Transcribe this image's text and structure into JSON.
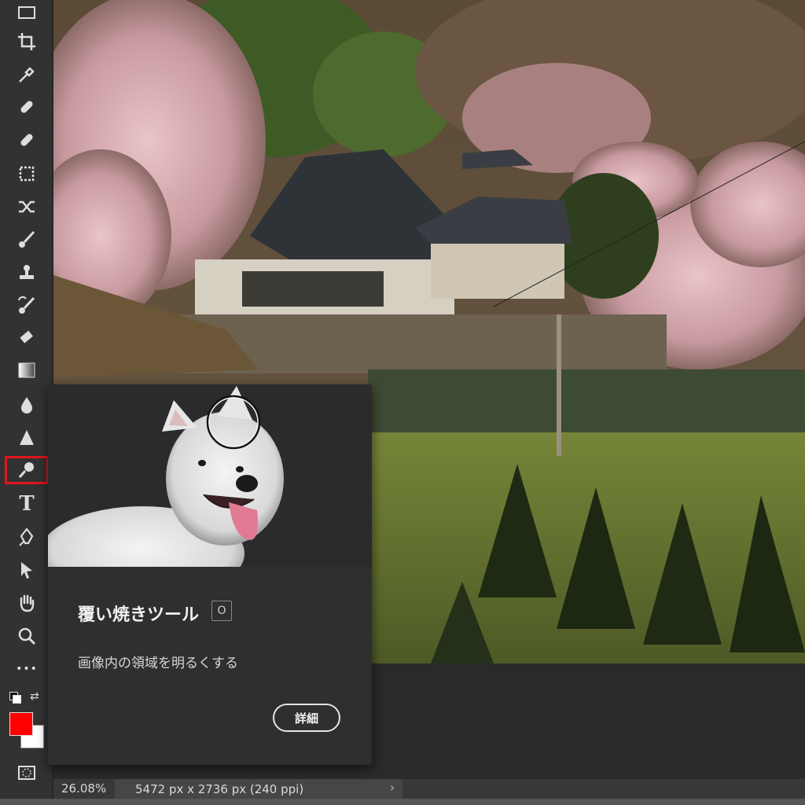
{
  "toolbar": {
    "tools": [
      {
        "name": "marquee-tool-icon"
      },
      {
        "name": "crop-tool-icon"
      },
      {
        "name": "eyedropper-tool-icon"
      },
      {
        "name": "spot-healing-tool-icon"
      },
      {
        "name": "healing-brush-tool-icon"
      },
      {
        "name": "patch-tool-icon"
      },
      {
        "name": "content-aware-move-tool-icon"
      },
      {
        "name": "brush-tool-icon"
      },
      {
        "name": "clone-stamp-tool-icon"
      },
      {
        "name": "history-brush-tool-icon"
      },
      {
        "name": "eraser-tool-icon"
      },
      {
        "name": "gradient-tool-icon"
      },
      {
        "name": "blur-tool-icon"
      },
      {
        "name": "sharpen-tool-icon"
      },
      {
        "name": "dodge-tool-icon"
      },
      {
        "name": "type-tool-icon"
      },
      {
        "name": "pen-tool-icon"
      },
      {
        "name": "path-selection-tool-icon"
      },
      {
        "name": "hand-tool-icon"
      },
      {
        "name": "zoom-tool-icon"
      },
      {
        "name": "more-tools-icon"
      }
    ],
    "type_glyph": "T",
    "more_glyph": "•••",
    "active_tool": "dodge-tool-icon",
    "highlight_color": "#e3141b",
    "foreground_color": "#ff0000",
    "background_color": "#ffffff"
  },
  "tooltip": {
    "title": "覆い焼きツール",
    "shortcut": "O",
    "description": "画像内の領域を明るくする",
    "more_button": "詳細"
  },
  "status": {
    "zoom": "26.08%",
    "document_info": "5472 px x 2736 px (240 ppi)",
    "chevron": "›"
  }
}
